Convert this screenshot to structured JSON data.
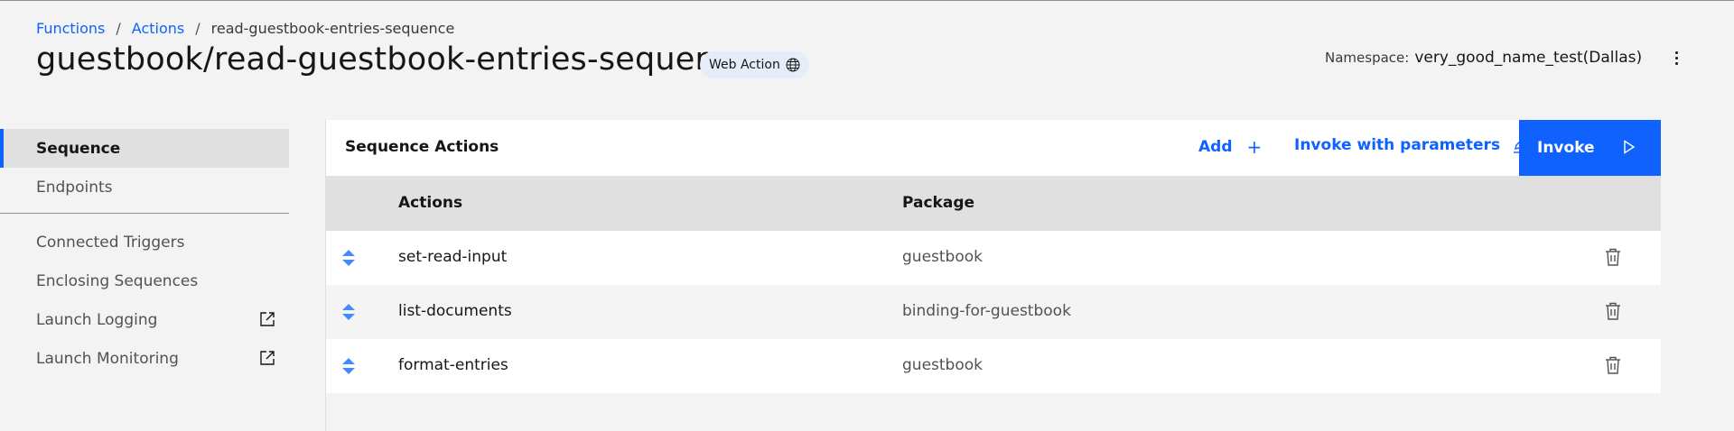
{
  "breadcrumb": {
    "items": [
      "Functions",
      "Actions"
    ],
    "separator": "/",
    "current": "read-guestbook-entries-sequence"
  },
  "header": {
    "title": "guestbook/read-guestbook-entries-sequence",
    "badge_label": "Web Action",
    "badge_icon": "globe-icon",
    "namespace_label": "Namespace:",
    "namespace_value": "very_good_name_test(Dallas)",
    "overflow_icon": "overflow-menu-icon"
  },
  "sidebar": {
    "primary": [
      {
        "label": "Sequence",
        "active": true
      },
      {
        "label": "Endpoints",
        "active": false
      }
    ],
    "secondary": [
      {
        "label": "Connected Triggers"
      },
      {
        "label": "Enclosing Sequences"
      },
      {
        "label": "Launch Logging",
        "icon": "launch-icon"
      },
      {
        "label": "Launch Monitoring",
        "icon": "launch-icon"
      }
    ]
  },
  "panel": {
    "title": "Sequence Actions",
    "add_label": "Add",
    "add_icon": "plus",
    "invoke_params_label": "Invoke with parameters",
    "invoke_params_icon": "edit-icon",
    "invoke_label": "Invoke",
    "invoke_icon": "play-icon",
    "columns": [
      "Actions",
      "Package"
    ],
    "rows": [
      {
        "action": "set-read-input",
        "package": "guestbook"
      },
      {
        "action": "list-documents",
        "package": "binding-for-guestbook"
      },
      {
        "action": "format-entries",
        "package": "guestbook"
      }
    ]
  },
  "colors": {
    "accent": "#0f62fe",
    "drag_handle": "#4589ff",
    "background": "#f3f3f3"
  }
}
